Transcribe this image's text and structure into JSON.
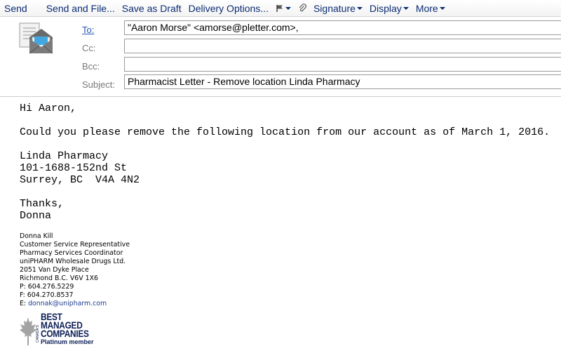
{
  "toolbar": {
    "send": "Send",
    "send_and_file": "Send and File...",
    "save_as_draft": "Save as Draft",
    "delivery_options": "Delivery Options...",
    "signature": "Signature",
    "display": "Display",
    "more": "More"
  },
  "header": {
    "to_label": "To:",
    "to_value": "\"Aaron Morse\" <amorse@pletter.com>,",
    "cc_label": "Cc:",
    "cc_value": "",
    "bcc_label": "Bcc:",
    "bcc_value": "",
    "subject_label": "Subject:",
    "subject_value": "Pharmacist Letter - Remove location Linda Pharmacy"
  },
  "body": {
    "greeting": "Hi Aaron,",
    "request": "Could you please remove the following location from our account as of March 1, 2016.",
    "location_name": "Linda Pharmacy",
    "location_street": "101-1688-152nd St",
    "location_city": "Surrey, BC  V4A 4N2",
    "closing": "Thanks,",
    "sender": "Donna"
  },
  "signature": {
    "name": "Donna Kill",
    "title1": "Customer Service Representative",
    "title2": "Pharmacy Services Coordinator",
    "company": "uniPHARM Wholesale Drugs Ltd.",
    "address1": "2051 Van Dyke Place",
    "address2": "Richmond B.C.   V6V 1X6",
    "phone": "P: 604.276.5229",
    "fax": "F: 604.270.8537",
    "email_prefix": "E: ",
    "email": "donnak@unipharm.com"
  },
  "logo": {
    "line1": "BEST",
    "line2": "MANAGED",
    "line3": "COMPANIES",
    "line4": "Platinum member",
    "side": "CANADA'S"
  },
  "colors": {
    "toolbar_text": "#0b2c73",
    "link": "#2454b4",
    "logo": "#0d1f57",
    "maple": "#9a9a9a"
  }
}
